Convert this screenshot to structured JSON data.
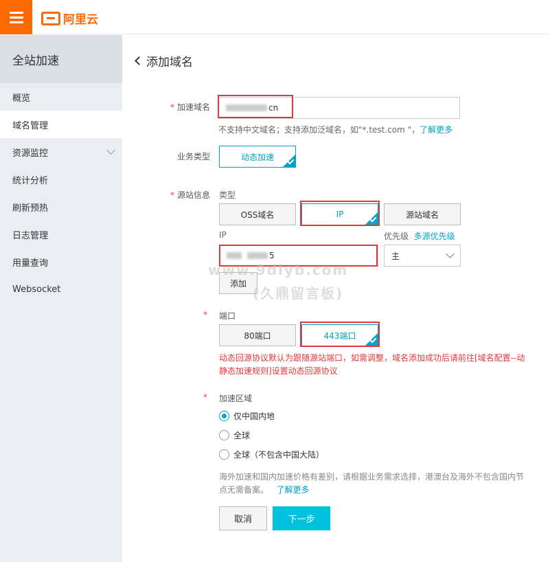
{
  "topbar": {
    "logo_text": "阿里云"
  },
  "sidebar": {
    "title": "全站加速",
    "items": [
      {
        "label": "概览"
      },
      {
        "label": "域名管理"
      },
      {
        "label": "资源监控"
      },
      {
        "label": "统计分析"
      },
      {
        "label": "刷新预热"
      },
      {
        "label": "日志管理"
      },
      {
        "label": "用量查询"
      },
      {
        "label": "Websocket"
      }
    ]
  },
  "page": {
    "title": "添加域名"
  },
  "form": {
    "domain": {
      "label": "加速域名",
      "value_suffix": "cn",
      "hint": "不支持中文域名；支持添加泛域名，如\"*.test.com \"，",
      "hint_link": "了解更多"
    },
    "biz_type": {
      "label": "业务类型",
      "selected": "动态加速"
    },
    "origin": {
      "label": "源站信息",
      "type_label": "类型",
      "types": [
        "OSS域名",
        "IP",
        "源站域名"
      ],
      "ip_label": "IP",
      "priority_label": "优先级",
      "priority_link": "多源优先级",
      "ip_value_suffix": "5",
      "priority_value": "主",
      "add_button": "添加"
    },
    "port": {
      "label": "端口",
      "options": [
        "80端口",
        "443端口"
      ],
      "warning_line1": "动态回源协议默认为跟随源站端口，如需调整，域名添加成功后请前往[域名配置--动",
      "warning_line2": "静态加速规则]设置动态回源协议"
    },
    "region": {
      "label": "加速区域",
      "options": [
        "仅中国内地",
        "全球",
        "全球（不包含中国大陆）"
      ],
      "note_line1": "海外加速和国内加速价格有差别，请根据业务需求选择，港澳台及海外不包含国内节",
      "note_line2": "点无需备案。",
      "note_link": "了解更多"
    },
    "actions": {
      "cancel": "取消",
      "next": "下一步"
    }
  },
  "watermark": {
    "line1": "www.9dlyb.com",
    "line2": "(久鼎留言板)"
  },
  "colors": {
    "brand": "#ff6a00",
    "accent": "#00a2ca",
    "primary_button": "#00c1de",
    "highlight": "#e4393c"
  }
}
